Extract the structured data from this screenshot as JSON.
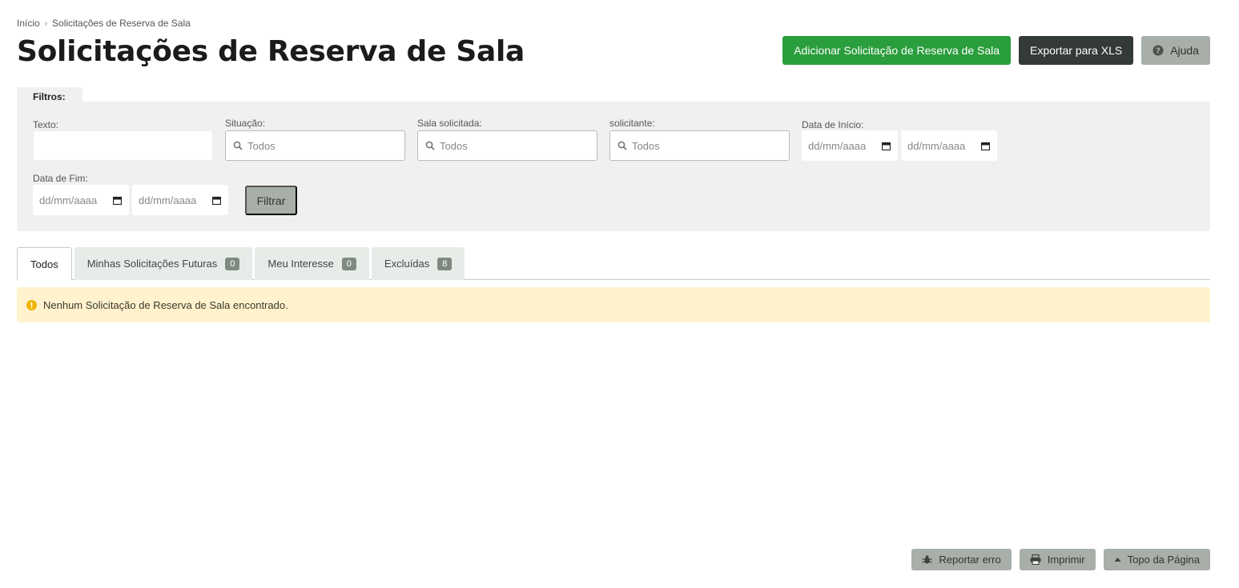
{
  "breadcrumb": {
    "home": "Início",
    "current": "Solicitações de Reserva de Sala"
  },
  "page_title": "Solicitações de Reserva de Sala",
  "actions": {
    "add": "Adicionar Solicitação de Reserva de Sala",
    "export": "Exportar para XLS",
    "help": "Ajuda"
  },
  "filters": {
    "tab_label": "Filtros:",
    "texto_label": "Texto:",
    "texto_value": "",
    "situacao_label": "Situação:",
    "situacao_value": "Todos",
    "sala_label": "Sala solicitada:",
    "sala_value": "Todos",
    "solicitante_label": "solicitante:",
    "solicitante_value": "Todos",
    "data_inicio_label": "Data de Início:",
    "data_fim_label": "Data de Fim:",
    "date_placeholder": "dd/mm/aaaa",
    "filter_button": "Filtrar"
  },
  "tabs": [
    {
      "label": "Todos",
      "count": null,
      "active": true
    },
    {
      "label": "Minhas Solicitações Futuras",
      "count": "0"
    },
    {
      "label": "Meu Interesse",
      "count": "0"
    },
    {
      "label": "Excluídas",
      "count": "8"
    }
  ],
  "alert": {
    "message": "Nenhum Solicitação de Reserva de Sala encontrado."
  },
  "footer": {
    "report": "Reportar erro",
    "print": "Imprimir",
    "top": "Topo da Página"
  },
  "colors": {
    "success": "#2a9d3c",
    "dark": "#343a35",
    "muted": "#a7afa8",
    "alert_bg": "#fff2cd",
    "warn": "#f0b400"
  }
}
